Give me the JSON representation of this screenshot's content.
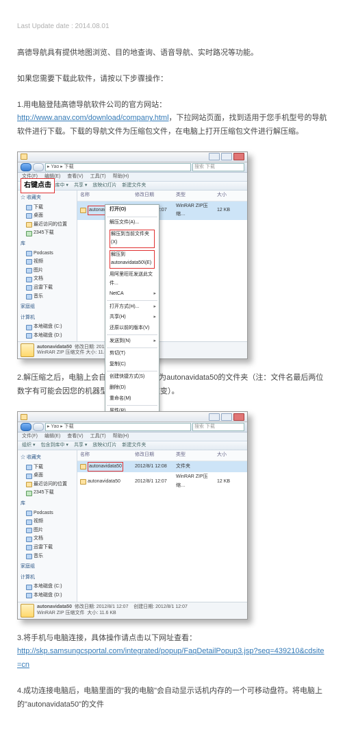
{
  "meta": {
    "updated_label": "Last Update date : 2014.08.01"
  },
  "intro": "高德导航具有提供地图浏览、目的地查询、语音导航、实时路况等功能。",
  "lead": "如果您需要下载此软件，请按以下步骤操作：",
  "step1": {
    "title": "1.用电脑登陆高德导航软件公司的官方网站：",
    "url": "http://www.anav.com/download/company.html",
    "tail": "，下拉网站页面，找到适用于您手机型号的导航软件进行下载。下载的导航文件为压缩包文件，在电脑上打开压缩包文件进行解压缩。"
  },
  "shot1": {
    "callout": "右键点击",
    "addr": "▸ Yao ▸ 下载",
    "search": "搜索 下载",
    "menus": [
      "文件(F)",
      "编辑(E)",
      "查看(V)",
      "工具(T)",
      "帮助(H)"
    ],
    "tools": [
      "组织 ▾",
      "包含到库中 ▾",
      "共享 ▾",
      "放映幻灯片",
      "新建文件夹"
    ],
    "sidebar_fav": "☆ 收藏夹",
    "sidebar_items1": [
      "下载",
      "桌面",
      "最近访问的位置",
      "2345下载"
    ],
    "sidebar_lib": "库",
    "sidebar_items2": [
      "Podcasts",
      "视频",
      "图片",
      "文档",
      "迅雷下载",
      "音乐"
    ],
    "sidebar_home": "家庭组",
    "sidebar_pc": "计算机",
    "sidebar_items3": [
      "本地磁盘 (C:)",
      "本地磁盘 (D:)"
    ],
    "header": [
      "名称",
      "修改日期",
      "类型",
      "大小"
    ],
    "file": {
      "name": "autonavidata50",
      "date": "2012/8/1 12:07",
      "type": "WinRAR ZIP压缩…",
      "size": "12 KB"
    },
    "status_name": "autonavidata50",
    "status_line1": "修改日期: 2012/8/1 12:07",
    "status_line2": "WinRAR ZIP 压缩文件   大小: 11.6 KB",
    "context": [
      "打开(O)",
      "解压文件(A)...",
      "解压到当前文件夹(X)",
      "解压到 autonavidata50\\(E)",
      "用阿里旺旺发送此文件...",
      "NetCA",
      "打开方式(H)...",
      "共享(H)",
      "还原以前的版本(V)",
      "发送到(N)",
      "剪切(T)",
      "复制(C)",
      "创建快捷方式(S)",
      "删除(D)",
      "重命名(M)",
      "属性(R)"
    ]
  },
  "step2": "2.解压缩之后，电脑上会自动出现一个名称为autonavidata50的文件夹（注：文件名最后两位数字有可能会因您的机器型号不同而发生改变）。",
  "shot2": {
    "header": [
      "名称",
      "修改日期",
      "类型",
      "大小"
    ],
    "folder": {
      "name": "autonavidata50",
      "date": "2012/8/1 12:08",
      "type": "文件夹"
    },
    "file": {
      "name": "autonavidata50",
      "date": "2012/8/1 12:07",
      "type": "WinRAR ZIP压缩…",
      "size": "12 KB"
    },
    "status_name": "autonavidata50",
    "status_line1": "修改日期: 2012/8/1 12:07",
    "status_sub": "WinRAR ZIP 压缩文件",
    "status_line2": "大小: 11.6 KB",
    "status_date": "创建日期: 2012/8/1 12:07"
  },
  "step3": {
    "title": "3.将手机与电脑连接，具体操作请点击以下网址查看：",
    "url": "http://skp.samsungcsportal.com/integrated/popup/FaqDetailPopup3.jsp?seq=439210&cdsite=cn"
  },
  "step4": "4.成功连接电脑后，电脑里面的\"我的电脑\"会自动显示话机内存的一个可移动盘符。将电脑上的\"autonavidata50\"的文件"
}
